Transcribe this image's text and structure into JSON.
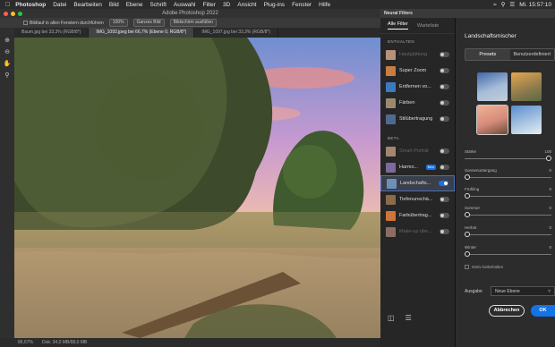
{
  "menubar": {
    "app": "Photoshop",
    "items": [
      "Datei",
      "Bearbeiten",
      "Bild",
      "Ebene",
      "Schrift",
      "Auswahl",
      "Filter",
      "3D",
      "Ansicht",
      "Plug-ins",
      "Fenster",
      "Hilfe"
    ],
    "clock": "Mi. 15:57:10"
  },
  "window": {
    "title": "Adobe Photoshop 2022"
  },
  "options": {
    "scroll_all": "Bildlauf in allen Fenstern durchführen",
    "zoom": "100%",
    "fit": "Ganzes Bild",
    "fill": "Bildschirm ausfüllen"
  },
  "tabs": [
    {
      "label": "Baum.jpg bei 33,3% (RGB/8*)",
      "active": false
    },
    {
      "label": "IMG_1093.jpeg bei 66,7% (Ebene 0, RGB/8*)",
      "active": true
    },
    {
      "label": "IMG_1097.jpg bei 33,3% (RGB/8*)",
      "active": false
    }
  ],
  "status": {
    "zoom": "86,67%",
    "doc": "Dok: 34,0 MB/68,0 MB"
  },
  "neural": {
    "panel_title": "Neural Filters",
    "tab_all": "Alle Filter",
    "tab_waitlist": "Warteliste",
    "section_included": "ENTHALTEN",
    "included": [
      {
        "label": "Hautglättung",
        "on": false,
        "dim": true
      },
      {
        "label": "Super Zoom",
        "on": false,
        "dim": false
      },
      {
        "label": "Entfernen vo...",
        "on": false,
        "dim": false
      },
      {
        "label": "Färben",
        "on": false,
        "dim": false
      },
      {
        "label": "Stilübertragung",
        "on": false,
        "dim": false
      }
    ],
    "section_beta": "BETA",
    "beta": [
      {
        "label": "Smart Porträt",
        "on": false,
        "dim": true,
        "badge": ""
      },
      {
        "label": "Harmo...",
        "on": false,
        "dim": false,
        "badge": "Neu"
      },
      {
        "label": "Landschafts...",
        "on": true,
        "dim": false,
        "badge": "",
        "selected": true
      },
      {
        "label": "Tiefenunschä...",
        "on": false,
        "dim": false,
        "badge": ""
      },
      {
        "label": "Farbübertrag...",
        "on": false,
        "dim": false,
        "badge": ""
      },
      {
        "label": "Make-up übe...",
        "on": false,
        "dim": true,
        "badge": ""
      }
    ],
    "filter_title": "Landschaftsmischer",
    "seg_presets": "Presets",
    "seg_custom": "Benutzerdefiniert",
    "sliders": [
      {
        "label": "Stärke",
        "value": "100",
        "level": 1.0
      },
      {
        "label": "Sonnenuntergang",
        "value": "0",
        "level": 0
      },
      {
        "label": "Frühling",
        "value": "0",
        "level": 0
      },
      {
        "label": "Sommer",
        "value": "0",
        "level": 0
      },
      {
        "label": "Herbst",
        "value": "0",
        "level": 0
      },
      {
        "label": "Winter",
        "value": "0",
        "level": 0
      }
    ],
    "keep_subject": "Motiv beibehalten",
    "output_label": "Ausgabe",
    "output_value": "Neue Ebene",
    "cancel": "Abbrechen",
    "ok": "OK"
  }
}
